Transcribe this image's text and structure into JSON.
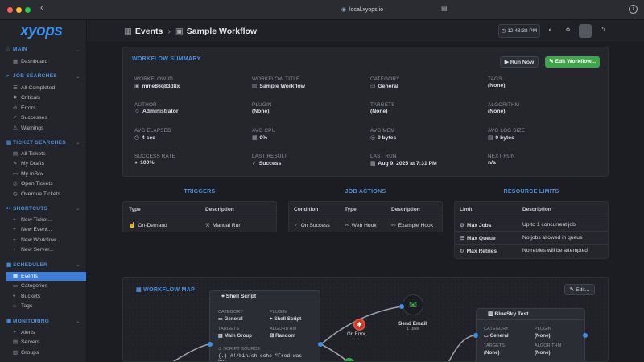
{
  "browser": {
    "url": "local.xyops.io"
  },
  "sidebar": {
    "logo": "xyops",
    "sections": [
      {
        "title": "MAIN",
        "icon": "home-icon",
        "items": [
          {
            "label": "Dashboard",
            "icon": "dashboard-icon"
          }
        ]
      },
      {
        "title": "JOB SEARCHES",
        "icon": "search-icon",
        "items": [
          {
            "label": "All Completed",
            "icon": "list-icon"
          },
          {
            "label": "Criticals",
            "icon": "fire-icon"
          },
          {
            "label": "Errors",
            "icon": "alert-icon"
          },
          {
            "label": "Successes",
            "icon": "check-icon"
          },
          {
            "label": "Warnings",
            "icon": "warning-icon"
          }
        ]
      },
      {
        "title": "TICKET SEARCHES",
        "icon": "ticket-icon",
        "items": [
          {
            "label": "All Tickets",
            "icon": "ticket-icon"
          },
          {
            "label": "My Drafts",
            "icon": "draft-icon"
          },
          {
            "label": "My InBox",
            "icon": "inbox-icon"
          },
          {
            "label": "Open Tickets",
            "icon": "open-icon"
          },
          {
            "label": "Overdue Tickets",
            "icon": "clock-icon"
          }
        ]
      },
      {
        "title": "SHORTCUTS",
        "icon": "link-icon",
        "items": [
          {
            "label": "New Ticket...",
            "icon": "plus-icon"
          },
          {
            "label": "New Event...",
            "icon": "plus-icon"
          },
          {
            "label": "New Workflow...",
            "icon": "plus-icon"
          },
          {
            "label": "New Server...",
            "icon": "plus-icon"
          }
        ]
      },
      {
        "title": "SCHEDULER",
        "icon": "calendar-icon",
        "items": [
          {
            "label": "Events",
            "icon": "calendar-icon",
            "active": true
          },
          {
            "label": "Categories",
            "icon": "folder-icon"
          },
          {
            "label": "Buckets",
            "icon": "bucket-icon"
          },
          {
            "label": "Tags",
            "icon": "tag-icon"
          }
        ]
      },
      {
        "title": "MONITORING",
        "icon": "monitor-icon",
        "items": [
          {
            "label": "Alerts",
            "icon": "bell-icon"
          },
          {
            "label": "Servers",
            "icon": "server-icon"
          },
          {
            "label": "Groups",
            "icon": "group-icon"
          }
        ]
      }
    ]
  },
  "header": {
    "crumb1": "Events",
    "crumb2": "Sample Workflow",
    "clock": "12:48:38 PM"
  },
  "summary": {
    "title": "WORKFLOW SUMMARY",
    "run_now": "Run Now",
    "edit_workflow": "Edit Workflow...",
    "fields": [
      {
        "label": "WORKFLOW ID",
        "value": "mme86q83d8x",
        "icon": "id-icon"
      },
      {
        "label": "WORKFLOW TITLE",
        "value": "Sample Workflow",
        "icon": "doc-icon"
      },
      {
        "label": "CATEGORY",
        "value": "General",
        "icon": "folder-icon"
      },
      {
        "label": "TAGS",
        "value": "(None)"
      },
      {
        "label": "AUTHOR",
        "value": "Administrator",
        "icon": "user-icon"
      },
      {
        "label": "PLUGIN",
        "value": "(None)"
      },
      {
        "label": "TARGETS",
        "value": "(None)"
      },
      {
        "label": "ALGORITHM",
        "value": "(None)"
      },
      {
        "label": "AVG ELAPSED",
        "value": "4 sec",
        "icon": "clock-icon"
      },
      {
        "label": "AVG CPU",
        "value": "0%",
        "icon": "cpu-icon"
      },
      {
        "label": "AVG MEM",
        "value": "0 bytes",
        "icon": "mem-icon"
      },
      {
        "label": "AVG LOG SIZE",
        "value": "0 bytes",
        "icon": "file-icon"
      },
      {
        "label": "SUCCESS RATE",
        "value": "100%",
        "icon": "pie-icon"
      },
      {
        "label": "LAST RESULT",
        "value": "Success",
        "icon": "check-icon"
      },
      {
        "label": "LAST RUN",
        "value": "Aug 9, 2025 at 7:31 PM",
        "icon": "calendar-icon"
      },
      {
        "label": "NEXT RUN",
        "value": "n/a"
      }
    ]
  },
  "triggers": {
    "title": "TRIGGERS",
    "headers": [
      "Type",
      "Description"
    ],
    "rows": [
      {
        "type": "On-Demand",
        "description": "Manual Run"
      }
    ]
  },
  "actions": {
    "title": "JOB ACTIONS",
    "headers": [
      "Condition",
      "Type",
      "Description"
    ],
    "rows": [
      {
        "condition": "On Success",
        "type": "Web Hook",
        "description": "Example Hook"
      }
    ]
  },
  "limits": {
    "title": "RESOURCE LIMITS",
    "headers": [
      "Limit",
      "Description"
    ],
    "rows": [
      {
        "limit": "Max Jobs",
        "description": "Up to 1 concurrent job"
      },
      {
        "limit": "Max Queue",
        "description": "No jobs allowed in queue"
      },
      {
        "limit": "Max Retries",
        "description": "No retries will be attempted"
      }
    ]
  },
  "map": {
    "title": "WORKFLOW MAP",
    "edit": "Edit...",
    "node1": {
      "title": "Shell Script",
      "cat_l": "CATEGORY",
      "cat_v": "General",
      "plug_l": "PLUGIN",
      "plug_v": "Shell Script",
      "tgt_l": "TARGETS",
      "tgt_v": "Main Group",
      "alg_l": "ALGORITHM",
      "alg_v": "Random",
      "src_l": "SCRIPT SOURCE",
      "src_v": "#!/bin/sh echo \"Fred was her..."
    },
    "on_error": "On Error",
    "email": {
      "title": "Send Email",
      "sub": "1 user"
    },
    "node2": {
      "title": "BlueSky Test",
      "cat_l": "CATEGORY",
      "cat_v": "General",
      "plug_l": "PLUGIN",
      "plug_v": "(None)",
      "tgt_l": "TARGETS",
      "tgt_v": "(None)",
      "alg_l": "ALGORITHM",
      "alg_v": "(None)"
    }
  }
}
